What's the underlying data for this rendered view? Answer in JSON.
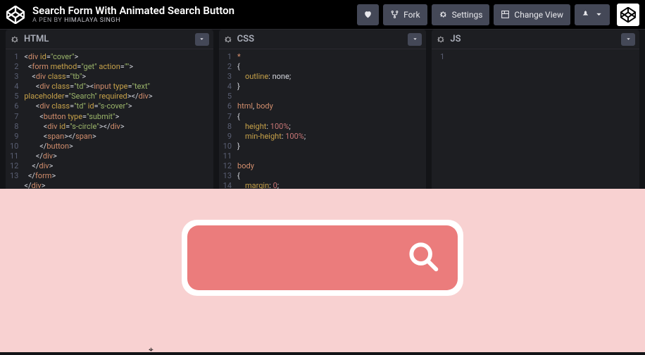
{
  "header": {
    "title": "Search Form With Animated Search Button",
    "byline_prefix": "A PEN BY",
    "author": "Himalaya Singh",
    "fork_label": "Fork",
    "settings_label": "Settings",
    "change_view_label": "Change View"
  },
  "panes": {
    "html": {
      "title": "HTML"
    },
    "css": {
      "title": "CSS"
    },
    "js": {
      "title": "JS"
    }
  },
  "code": {
    "html_lines": [
      "1",
      "2",
      "3",
      "4",
      "5",
      "6",
      "7",
      "8",
      "9",
      "10",
      "11",
      "12",
      "13"
    ],
    "css_lines": [
      "1",
      "2",
      "3",
      "4",
      "5",
      "6",
      "7",
      "8",
      "9",
      "10",
      "11",
      "12",
      "13",
      "14"
    ],
    "js_lines": [
      "1"
    ]
  }
}
